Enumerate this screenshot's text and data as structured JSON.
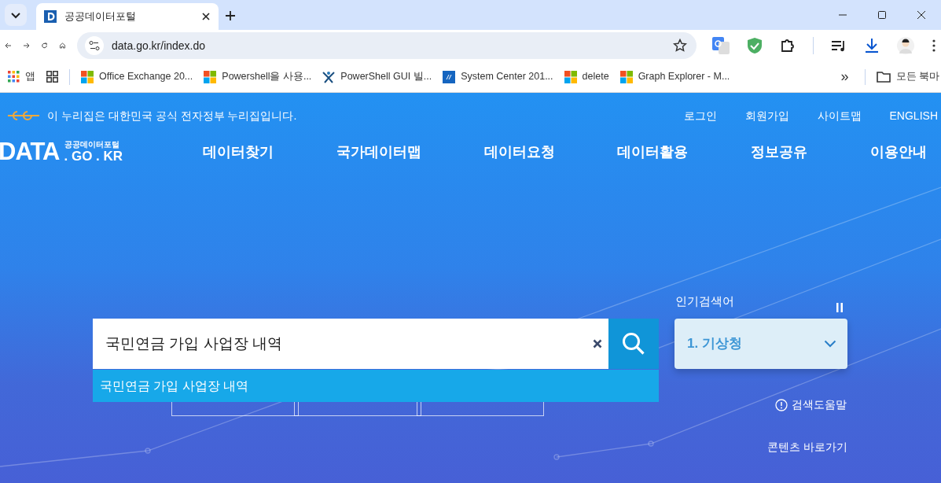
{
  "browser": {
    "tabs": [
      {
        "title": "공공데이터포털",
        "selected": true
      }
    ],
    "url": "data.go.kr/index.do",
    "bookmarks": [
      {
        "label": "앱",
        "kind": "apps"
      },
      {
        "kind": "groups"
      },
      {
        "label": "Office Exchange 20...",
        "kind": "windows"
      },
      {
        "label": "Powershell을 사용...",
        "kind": "windows"
      },
      {
        "label": "PowerShell GUI 빌...",
        "kind": "figure"
      },
      {
        "label": "System Center 201...",
        "kind": "square"
      },
      {
        "label": "delete",
        "kind": "windows"
      },
      {
        "label": "Graph Explorer - M...",
        "kind": "windows"
      }
    ],
    "bookmark_overflow": "»",
    "bookmark_folder": "모든 북마"
  },
  "site": {
    "notice": "이 누리집은 대한민국 공식 전자정부 누리집입니다.",
    "util_links": [
      "로그인",
      "회원가입",
      "사이트맵",
      "ENGLISH"
    ],
    "logo": {
      "main": "DATA",
      "sub": "공공데이터포털",
      "domain": ". GO . KR"
    },
    "nav": [
      "데이터찾기",
      "국가데이터맵",
      "데이터요청",
      "데이터활용",
      "정보공유",
      "이용안내"
    ],
    "search": {
      "value": "국민연금 가입 사업장 내역",
      "suggestions": [
        {
          "text": "국민연금 가입 사업장 내역",
          "selected": true
        }
      ]
    },
    "popular": {
      "label": "인기검색어",
      "current": "1. 기상청"
    },
    "help": "검색도움말",
    "skip_link": "콘텐츠 바로가기"
  }
}
